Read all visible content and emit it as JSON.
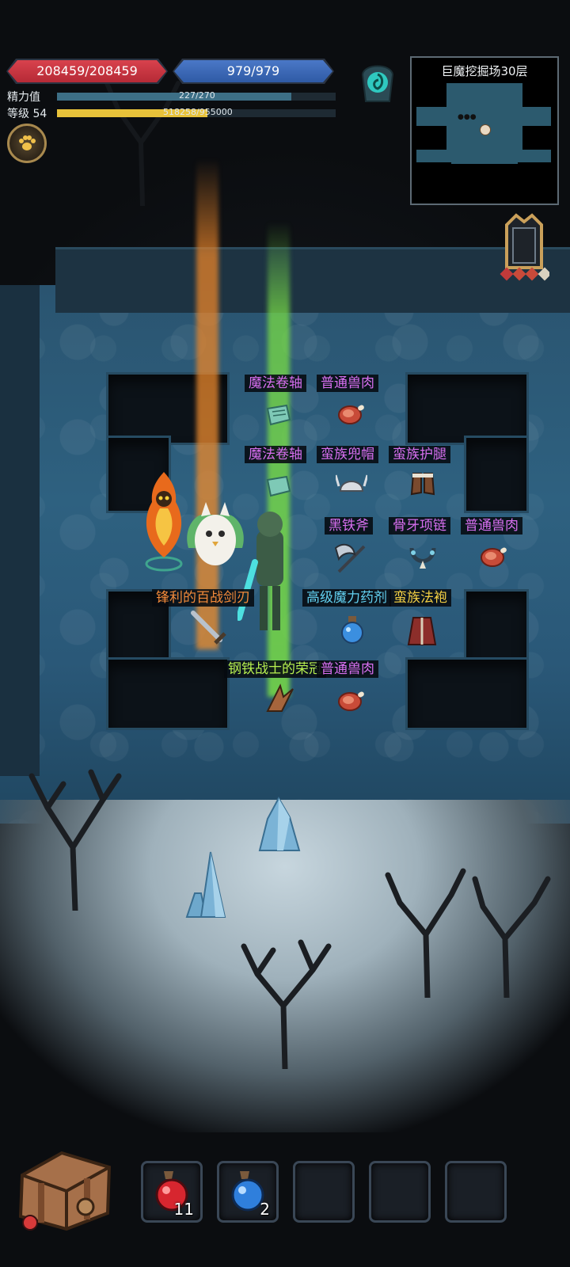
{
  "hud": {
    "hp": "208459/208459",
    "mp": "979/979",
    "stamina": {
      "label": "精力值",
      "value": "227/270",
      "fraction": 0.84
    },
    "level": {
      "label": "等级 54",
      "xp": "518258/955000",
      "fraction": 0.54
    }
  },
  "minimap": {
    "title": "巨魔挖掘场30层"
  },
  "items": [
    {
      "label": "魔法卷轴",
      "quality": "purple",
      "icon": "scroll-icon"
    },
    {
      "label": "普通兽肉",
      "quality": "purple",
      "icon": "meat-icon"
    },
    {
      "label": "魔法卷轴",
      "quality": "purple",
      "icon": "scroll-icon"
    },
    {
      "label": "蛮族兜帽",
      "quality": "purple",
      "icon": "helmet-icon"
    },
    {
      "label": "蛮族护腿",
      "quality": "purple",
      "icon": "boots-icon"
    },
    {
      "label": "黑铁斧",
      "quality": "purple",
      "icon": "axe-icon"
    },
    {
      "label": "骨牙项链",
      "quality": "purple",
      "icon": "necklace-icon"
    },
    {
      "label": "普通兽肉",
      "quality": "purple",
      "icon": "meat-icon"
    },
    {
      "label": "锋利的百战剑刃",
      "quality": "orange",
      "icon": "sword-icon"
    },
    {
      "label": "高级魔力药剂",
      "quality": "cyan",
      "icon": "mana-potion-icon"
    },
    {
      "label": "蛮族法袍",
      "quality": "yellow",
      "icon": "robe-icon"
    },
    {
      "label": "钢铁战士的荣冠",
      "quality": "green",
      "icon": "crest-icon"
    },
    {
      "label": "普通兽肉",
      "quality": "purple",
      "icon": "meat-icon"
    }
  ],
  "quickbar": [
    {
      "icon": "health-potion-icon",
      "count": "11"
    },
    {
      "icon": "mana-potion-icon",
      "count": "2"
    },
    {
      "icon": "",
      "count": ""
    },
    {
      "icon": "",
      "count": ""
    },
    {
      "icon": "",
      "count": ""
    }
  ],
  "colors": {
    "hp": "#c8323f",
    "mp": "#3c68b6",
    "stamina": "#3d6f86",
    "xp": "#e8c23a",
    "purple": "#d86ff0",
    "orange": "#f28a3a",
    "cyan": "#62d0f0",
    "yellow": "#f3cf43",
    "green": "#b7f050"
  }
}
